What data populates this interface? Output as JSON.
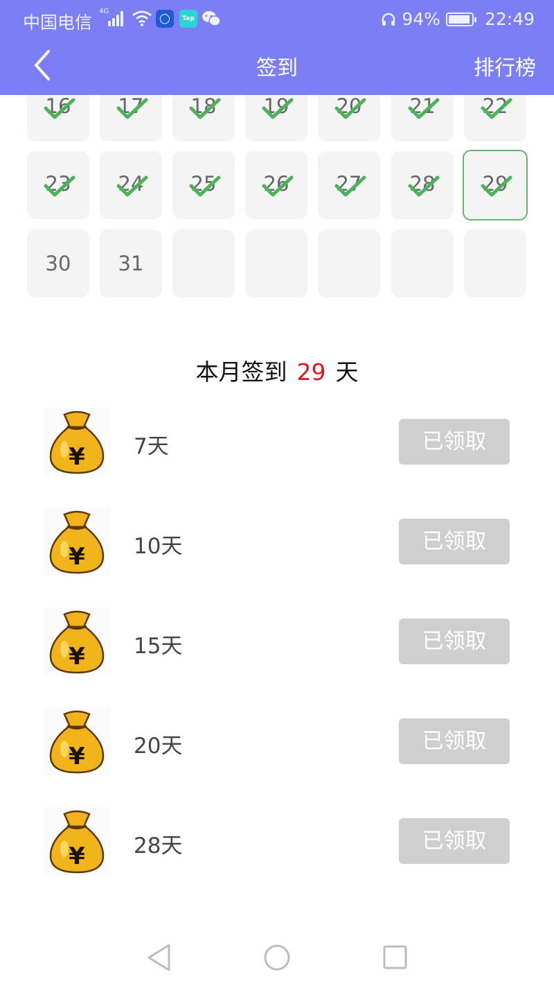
{
  "status": {
    "carrier": "中国电信",
    "network": "4G",
    "battery": "94%",
    "battery_level": 0.94,
    "time": "22:49",
    "app_tap_label": "Tap"
  },
  "header": {
    "title": "签到",
    "rank_label": "排行榜",
    "back_icon": "chevron-left-icon"
  },
  "calendar": {
    "days": [
      {
        "day": "16",
        "signed": true,
        "today": false
      },
      {
        "day": "17",
        "signed": true,
        "today": false
      },
      {
        "day": "18",
        "signed": true,
        "today": false
      },
      {
        "day": "19",
        "signed": true,
        "today": false
      },
      {
        "day": "20",
        "signed": true,
        "today": false
      },
      {
        "day": "21",
        "signed": true,
        "today": false
      },
      {
        "day": "22",
        "signed": true,
        "today": false
      },
      {
        "day": "23",
        "signed": true,
        "today": false
      },
      {
        "day": "24",
        "signed": true,
        "today": false
      },
      {
        "day": "25",
        "signed": true,
        "today": false
      },
      {
        "day": "26",
        "signed": true,
        "today": false
      },
      {
        "day": "27",
        "signed": true,
        "today": false
      },
      {
        "day": "28",
        "signed": true,
        "today": false
      },
      {
        "day": "29",
        "signed": true,
        "today": true
      },
      {
        "day": "30",
        "signed": false,
        "today": false
      },
      {
        "day": "31",
        "signed": false,
        "today": false
      },
      {
        "day": "",
        "signed": false,
        "today": false
      },
      {
        "day": "",
        "signed": false,
        "today": false
      },
      {
        "day": "",
        "signed": false,
        "today": false
      },
      {
        "day": "",
        "signed": false,
        "today": false
      },
      {
        "day": "",
        "signed": false,
        "today": false
      }
    ]
  },
  "summary": {
    "prefix": "本月签到",
    "count": "29",
    "suffix": "天"
  },
  "rewards": [
    {
      "label": "7天",
      "button": "已领取",
      "icon": "money-bag-icon"
    },
    {
      "label": "10天",
      "button": "已领取",
      "icon": "money-bag-icon"
    },
    {
      "label": "15天",
      "button": "已领取",
      "icon": "money-bag-icon"
    },
    {
      "label": "20天",
      "button": "已领取",
      "icon": "money-bag-icon"
    },
    {
      "label": "28天",
      "button": "已领取",
      "icon": "money-bag-icon"
    }
  ],
  "colors": {
    "header_bg": "#7b7ef4",
    "check_green": "#4db35a",
    "today_border": "#5fb96a",
    "count_red": "#e0141e",
    "claimed_button": "#cfcfcf"
  },
  "navbar": {
    "back": "nav-back-icon",
    "home": "nav-home-icon",
    "recents": "nav-recents-icon"
  }
}
